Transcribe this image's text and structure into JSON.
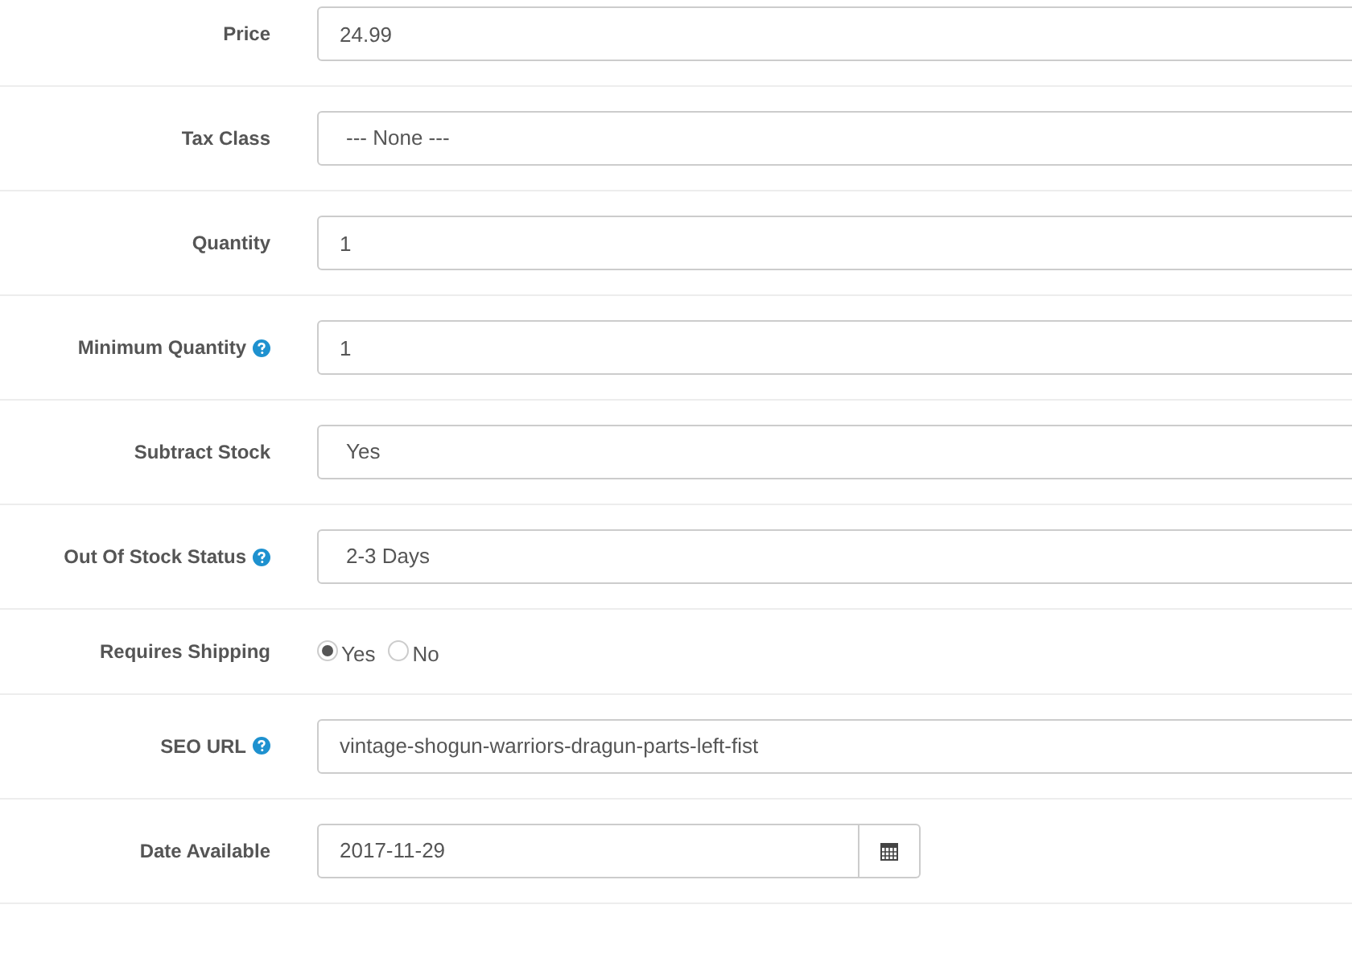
{
  "fields": [
    {
      "kind": "text",
      "label": "Price",
      "help": false,
      "value": "24.99"
    },
    {
      "kind": "select",
      "label": "Tax Class",
      "help": false,
      "value": "--- None ---"
    },
    {
      "kind": "text",
      "label": "Quantity",
      "help": false,
      "value": "1"
    },
    {
      "kind": "text",
      "label": "Minimum Quantity",
      "help": true,
      "value": "1"
    },
    {
      "kind": "select",
      "label": "Subtract Stock",
      "help": false,
      "value": "Yes"
    },
    {
      "kind": "select",
      "label": "Out Of Stock Status",
      "help": true,
      "value": "2-3 Days"
    },
    {
      "kind": "radio",
      "label": "Requires Shipping",
      "help": false,
      "options": [
        {
          "label": "Yes",
          "selected": true
        },
        {
          "label": "No",
          "selected": false
        }
      ]
    },
    {
      "kind": "text",
      "label": "SEO URL",
      "help": true,
      "value": "vintage-shogun-warriors-dragun-parts-left-fist"
    },
    {
      "kind": "date",
      "label": "Date Available",
      "help": false,
      "value": "2017-11-29"
    }
  ]
}
